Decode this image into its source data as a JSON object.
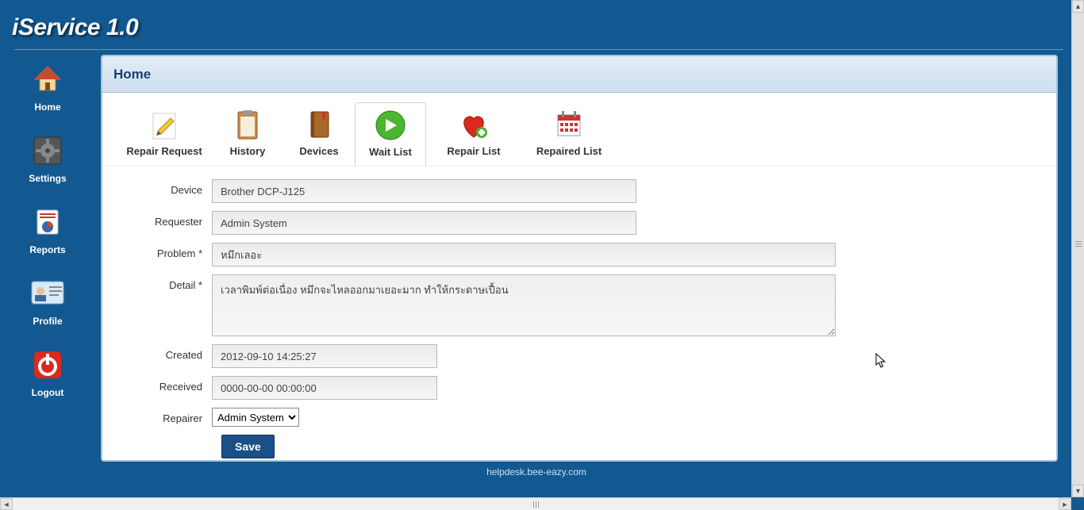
{
  "app": {
    "title": "iService 1.0"
  },
  "sidebar": {
    "items": [
      {
        "label": "Home",
        "icon": "home-icon"
      },
      {
        "label": "Settings",
        "icon": "gear-icon"
      },
      {
        "label": "Reports",
        "icon": "report-icon"
      },
      {
        "label": "Profile",
        "icon": "profile-icon"
      },
      {
        "label": "Logout",
        "icon": "power-icon"
      }
    ]
  },
  "panel": {
    "title": "Home"
  },
  "toolbar": {
    "items": [
      {
        "label": "Repair Request",
        "icon": "edit-icon"
      },
      {
        "label": "History",
        "icon": "clipboard-icon"
      },
      {
        "label": "Devices",
        "icon": "book-icon"
      },
      {
        "label": "Wait List",
        "icon": "arrow-right-icon"
      },
      {
        "label": "Repair List",
        "icon": "heart-plus-icon"
      },
      {
        "label": "Repaired List",
        "icon": "calendar-icon"
      }
    ],
    "active_index": 3
  },
  "form": {
    "labels": {
      "device": "Device",
      "requester": "Requester",
      "problem": "Problem *",
      "detail": "Detail *",
      "created": "Created",
      "received": "Received",
      "repairer": "Repairer"
    },
    "values": {
      "device": "Brother DCP-J125",
      "requester": "Admin System",
      "problem": "หมึกเลอะ",
      "detail": "เวลาพิมพ์ต่อเนื่อง หมึกจะไหลออกมาเยอะมาก ทำให้กระดาษเปื้อน",
      "created": "2012-09-10 14:25:27",
      "received": "0000-00-00 00:00:00",
      "repairer": "Admin System"
    },
    "repairer_options": [
      "Admin System"
    ],
    "save_label": "Save"
  },
  "footer": {
    "text": "helpdesk.bee-eazy.com"
  }
}
